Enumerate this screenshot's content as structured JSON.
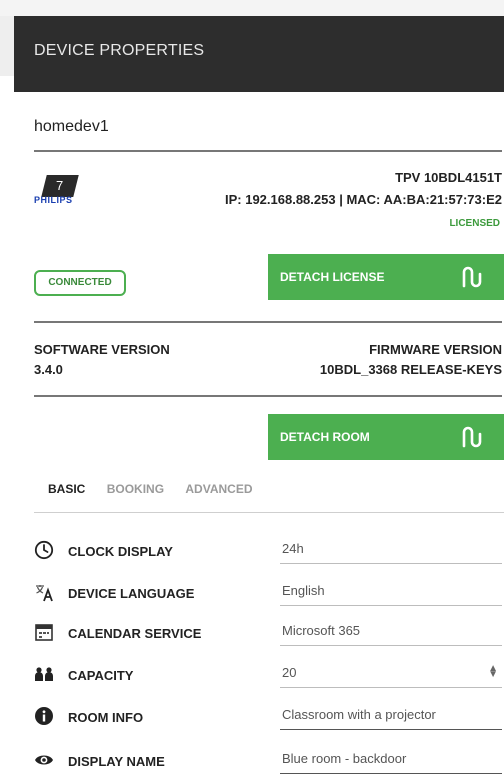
{
  "header": {
    "title": "DEVICE PROPERTIES"
  },
  "device": {
    "name": "homedev1",
    "logo_number": "7",
    "brand": "PHILIPS",
    "model": "TPV 10BDL4151T",
    "ip_mac": "IP: 192.168.88.253 | MAC: AA:BA:21:57:73:E2",
    "license_status": "LICENSED",
    "connection_status": "CONNECTED"
  },
  "buttons": {
    "detach_license": "DETACH LICENSE",
    "detach_room": "DETACH ROOM"
  },
  "versions": {
    "software_label": "SOFTWARE VERSION",
    "software_value": "3.4.0",
    "firmware_label": "FIRMWARE VERSION",
    "firmware_value": "10BDL_3368 RELEASE-KEYS"
  },
  "tabs": [
    {
      "label": "BASIC",
      "active": true
    },
    {
      "label": "BOOKING",
      "active": false
    },
    {
      "label": "ADVANCED",
      "active": false
    }
  ],
  "fields": {
    "clock_display": {
      "label": "CLOCK DISPLAY",
      "value": "24h",
      "icon": "clock-icon"
    },
    "device_language": {
      "label": "DEVICE LANGUAGE",
      "value": "English",
      "icon": "translate-icon"
    },
    "calendar_service": {
      "label": "CALENDAR SERVICE",
      "value": "Microsoft 365",
      "icon": "calendar-icon"
    },
    "capacity": {
      "label": "CAPACITY",
      "value": "20",
      "icon": "people-icon"
    },
    "room_info": {
      "label": "ROOM INFO",
      "value": "Classroom with a projector",
      "icon": "info-icon"
    },
    "display_name": {
      "label": "DISPLAY NAME",
      "value": "Blue room - backdoor",
      "icon": "eye-icon"
    }
  },
  "colors": {
    "header_bg": "#2d2d2d",
    "accent_green": "#4caf50"
  }
}
